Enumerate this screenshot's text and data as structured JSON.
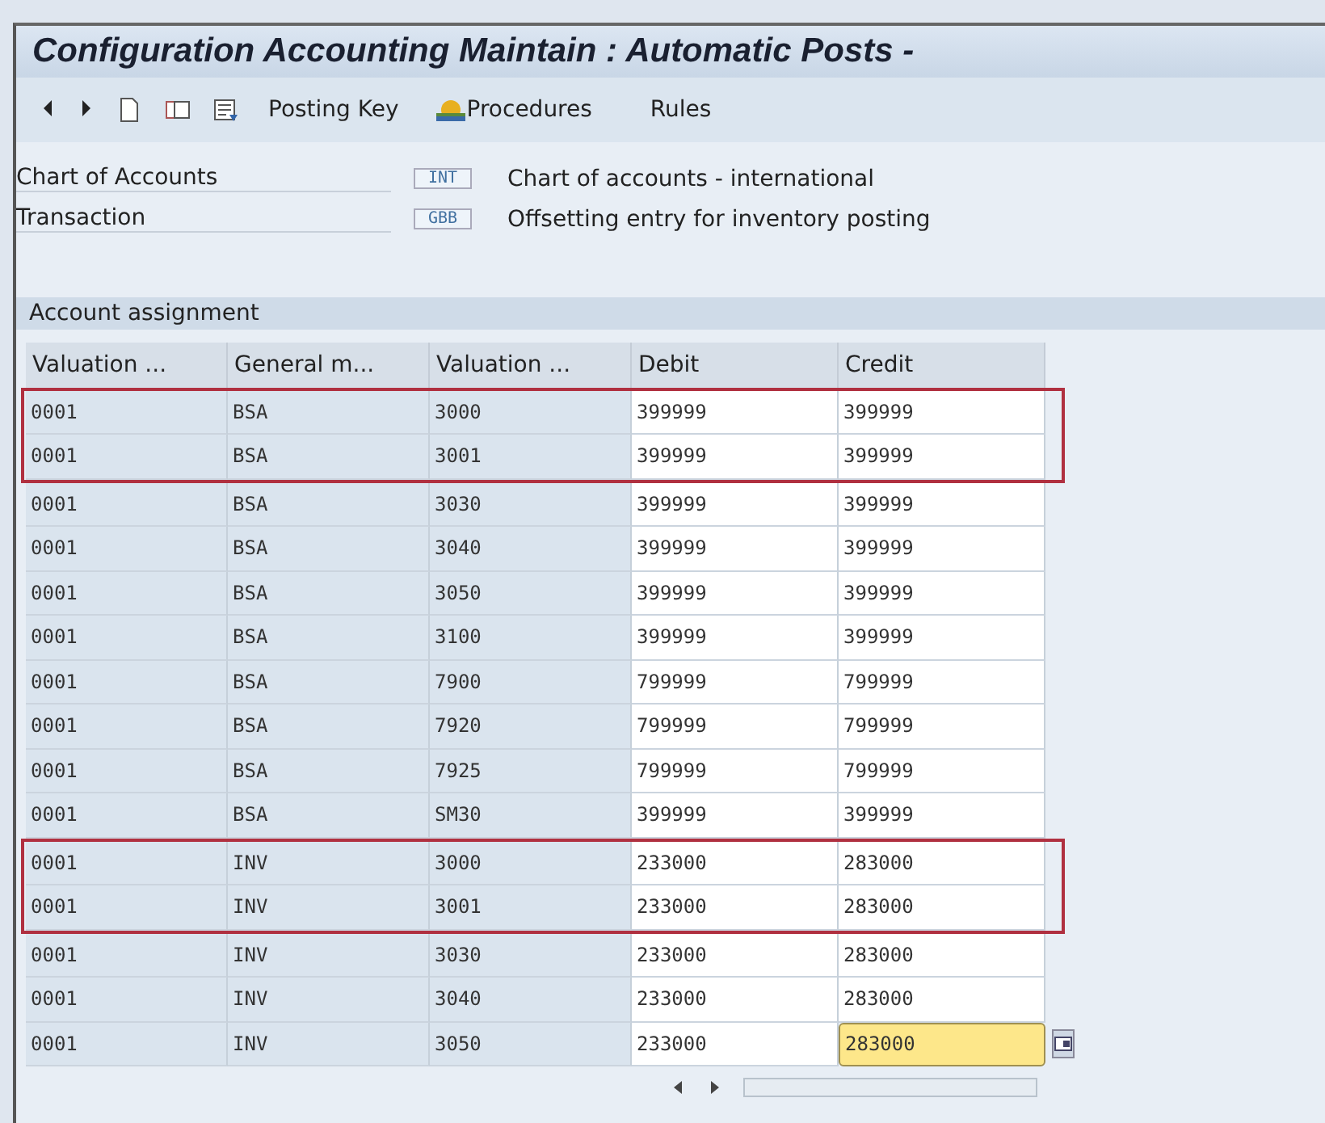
{
  "window": {
    "title": "Configuration Accounting Maintain : Automatic Posts -"
  },
  "toolbar": {
    "buttons": [
      {
        "kind": "back"
      },
      {
        "kind": "forward"
      },
      {
        "kind": "new"
      },
      {
        "kind": "copy"
      },
      {
        "kind": "list"
      },
      {
        "kind": "text",
        "label": "Posting Key"
      },
      {
        "kind": "procedures",
        "label": "Procedures"
      },
      {
        "kind": "text",
        "label": "Rules"
      }
    ]
  },
  "fields": [
    {
      "label": "Chart of Accounts",
      "value": "INT",
      "description": "Chart of accounts - international"
    },
    {
      "label": "Transaction",
      "value": "GBB",
      "description": "Offsetting entry for inventory posting"
    }
  ],
  "table": {
    "title": "Account assignment",
    "columns": [
      "Valuation ...",
      "General m...",
      "Valuation ...",
      "Debit",
      "Credit"
    ],
    "rows": [
      {
        "cells": [
          "0001",
          "BSA",
          "3000",
          "399999",
          "399999"
        ],
        "highlighted": true,
        "focused": false
      },
      {
        "cells": [
          "0001",
          "BSA",
          "3001",
          "399999",
          "399999"
        ],
        "highlighted": true,
        "focused": false
      },
      {
        "cells": [
          "0001",
          "BSA",
          "3030",
          "399999",
          "399999"
        ],
        "highlighted": false,
        "focused": false
      },
      {
        "cells": [
          "0001",
          "BSA",
          "3040",
          "399999",
          "399999"
        ],
        "highlighted": false,
        "focused": false
      },
      {
        "cells": [
          "0001",
          "BSA",
          "3050",
          "399999",
          "399999"
        ],
        "highlighted": false,
        "focused": false
      },
      {
        "cells": [
          "0001",
          "BSA",
          "3100",
          "399999",
          "399999"
        ],
        "highlighted": false,
        "focused": false
      },
      {
        "cells": [
          "0001",
          "BSA",
          "7900",
          "799999",
          "799999"
        ],
        "highlighted": false,
        "focused": false
      },
      {
        "cells": [
          "0001",
          "BSA",
          "7920",
          "799999",
          "799999"
        ],
        "highlighted": false,
        "focused": false
      },
      {
        "cells": [
          "0001",
          "BSA",
          "7925",
          "799999",
          "799999"
        ],
        "highlighted": false,
        "focused": false
      },
      {
        "cells": [
          "0001",
          "BSA",
          "SM30",
          "399999",
          "399999"
        ],
        "highlighted": false,
        "focused": false
      },
      {
        "cells": [
          "0001",
          "INV",
          "3000",
          "233000",
          "283000"
        ],
        "highlighted": true,
        "focused": false
      },
      {
        "cells": [
          "0001",
          "INV",
          "3001",
          "233000",
          "283000"
        ],
        "highlighted": true,
        "focused": false
      },
      {
        "cells": [
          "0001",
          "INV",
          "3030",
          "233000",
          "283000"
        ],
        "highlighted": false,
        "focused": false
      },
      {
        "cells": [
          "0001",
          "INV",
          "3040",
          "233000",
          "283000"
        ],
        "highlighted": false,
        "focused": false
      },
      {
        "cells": [
          "0001",
          "INV",
          "3050",
          "233000",
          "283000"
        ],
        "highlighted": false,
        "focused": true
      }
    ]
  }
}
